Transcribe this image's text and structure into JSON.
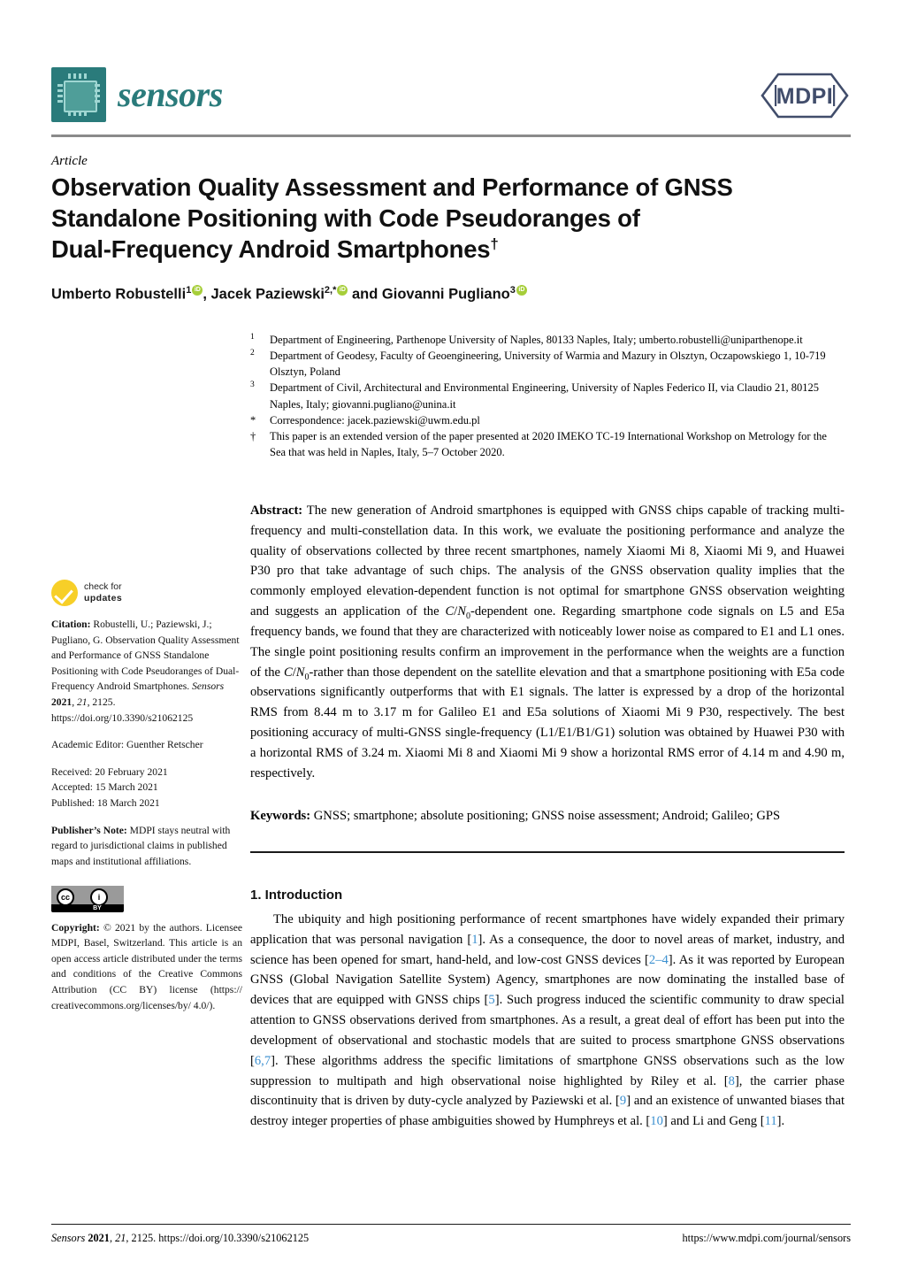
{
  "header": {
    "journal_name": "sensors",
    "logo_icon": "chip-icon",
    "publisher_logo_text": "MDPI",
    "logo_color": "#2a7b7b",
    "publisher_color": "#414d6b"
  },
  "article": {
    "kind": "Article",
    "title_line1": "Observation Quality Assessment and Performance of GNSS",
    "title_line2": "Standalone Positioning with Code Pseudoranges of",
    "title_line3": "Dual-Frequency Android Smartphones",
    "title_dagger": "†"
  },
  "authors": {
    "a1_name": "Umberto Robustelli",
    "a1_sup": "1",
    "sep1": ", ",
    "a2_name": "Jacek Paziewski",
    "a2_sup": "2,*",
    "conj": " and ",
    "a3_name": "Giovanni Pugliano",
    "a3_sup": "3"
  },
  "affiliations": [
    {
      "marker": "1",
      "text": "Department of Engineering, Parthenope University of Naples, 80133 Naples, Italy; umberto.robustelli@uniparthenope.it"
    },
    {
      "marker": "2",
      "text": "Department of Geodesy, Faculty of Geoengineering, University of Warmia and Mazury in Olsztyn, Oczapowskiego 1, 10-719 Olsztyn, Poland"
    },
    {
      "marker": "3",
      "text": "Department of Civil, Architectural and Environmental Engineering, University of Naples Federico II, via Claudio 21, 80125 Naples, Italy; giovanni.pugliano@unina.it"
    },
    {
      "marker": "*",
      "text": "Correspondence: jacek.paziewski@uwm.edu.pl"
    },
    {
      "marker": "†",
      "text": "This paper is an extended version of the paper presented at 2020 IMEKO TC-19 International Workshop on Metrology for the Sea that was held in Naples, Italy, 5–7 October 2020."
    }
  ],
  "abstract": {
    "label": "Abstract:",
    "p1": " The new generation of Android smartphones is equipped with GNSS chips capable of tracking multi-frequency and multi-constellation data. In this work, we evaluate the positioning performance and analyze the quality of observations collected by three recent smartphones, namely Xiaomi Mi 8, Xiaomi Mi 9, and Huawei P30 pro that take advantage of such chips. The analysis of the GNSS observation quality implies that the commonly employed elevation-dependent function is not optimal for smartphone GNSS observation weighting and suggests an application of the ",
    "formula1_c": "C",
    "formula1_slash": "/",
    "formula1_n": "N",
    "formula1_sub": "0",
    "p2": "-dependent one. Regarding smartphone code signals on L5 and E5a frequency bands, we found that they are characterized with noticeably lower noise as compared to E1 and L1 ones. The single point positioning results confirm an improvement in the performance when the weights are a function of the ",
    "formula2_c": "C",
    "formula2_slash": "/",
    "formula2_n": "N",
    "formula2_sub": "0",
    "p3": "-rather than those dependent on the satellite elevation and that a smartphone positioning with E5a code observations significantly outperforms that with E1 signals. The latter is expressed by a drop of the horizontal RMS from 8.44 m to 3.17 m for Galileo E1 and E5a solutions of Xiaomi Mi 9 P30, respectively. The best positioning accuracy of multi-GNSS single-frequency (L1/E1/B1/G1) solution was obtained by Huawei P30 with a horizontal RMS of 3.24 m. Xiaomi Mi 8 and Xiaomi Mi 9 show a horizontal RMS error of 4.14 m and 4.90 m, respectively."
  },
  "keywords": {
    "label": "Keywords:",
    "text": " GNSS; smartphone; absolute positioning; GNSS noise assessment; Android; Galileo; GPS"
  },
  "body": {
    "section_heading": "1. Introduction",
    "para_segments": [
      {
        "t": "The ubiquity and high positioning performance of recent smartphones have widely expanded their primary application that was personal navigation ["
      },
      {
        "cite": "1"
      },
      {
        "t": "]. As a consequence, the door to novel areas of market, industry, and science has been opened for smart, hand-held, and low-cost GNSS devices ["
      },
      {
        "cite": "2–4"
      },
      {
        "t": "]. As it was reported by European GNSS (Global Navigation Satellite System) Agency, smartphones are now dominating the installed base of devices that are equipped with GNSS chips ["
      },
      {
        "cite": "5"
      },
      {
        "t": "]. Such progress induced the scientific community to draw special attention to GNSS observations derived from smartphones. As a result, a great deal of effort has been put into the development of observational and stochastic models that are suited to process smartphone GNSS observations ["
      },
      {
        "cite": "6,7"
      },
      {
        "t": "]. These algorithms address the specific limitations of smartphone GNSS observations such as the low suppression to multipath and high observational noise highlighted by Riley et al. ["
      },
      {
        "cite": "8"
      },
      {
        "t": "], the carrier phase discontinuity that is driven by duty-cycle analyzed by Paziewski et al. ["
      },
      {
        "cite": "9"
      },
      {
        "t": "] and an existence of unwanted biases that destroy integer properties of phase ambiguities showed by Humphreys et al. ["
      },
      {
        "cite": "10"
      },
      {
        "t": "] and Li and Geng ["
      },
      {
        "cite": "11"
      },
      {
        "t": "]."
      }
    ],
    "cite_color": "#3a8fd0"
  },
  "sidebar": {
    "check_updates_line1": "check for",
    "check_updates_line2": "updates",
    "check_updates_color": "#f7cf28",
    "citation_label": "Citation:",
    "citation_text": " Robustelli, U.; Paziewski, J.; Pugliano, G. Observation Quality Assessment and Performance of GNSS Standalone Positioning with Code Pseudoranges of Dual-Frequency Android Smartphones. ",
    "citation_journal": "Sensors",
    "citation_year": "2021",
    "citation_vol": "21",
    "citation_art": "2125",
    "citation_doi": "https://doi.org/10.3390/s21062125",
    "academic_editor": "Academic Editor: Guenther Retscher",
    "received": "Received: 20 February 2021",
    "accepted": "Accepted: 15 March 2021",
    "published": "Published: 18 March 2021",
    "publishers_note_label": "Publisher’s Note:",
    "publishers_note_text": " MDPI stays neutral with regard to jurisdictional claims in published maps and institutional affiliations.",
    "cc_badge": {
      "cc_glyph": "cc",
      "by_glyph": "i",
      "by_label": "BY"
    },
    "copyright_label": "Copyright:",
    "copyright_text": " © 2021 by the authors. Licensee MDPI, Basel, Switzerland. This article is an open access article distributed under the terms and conditions of the Creative Commons Attribution (CC BY) license (https:// creativecommons.org/licenses/by/ 4.0/)."
  },
  "footer": {
    "left_journal": "Sensors",
    "left_year": "2021",
    "left_vol": "21",
    "left_rest": ", 2125. https://doi.org/10.3390/s21062125",
    "right": "https://www.mdpi.com/journal/sensors"
  }
}
